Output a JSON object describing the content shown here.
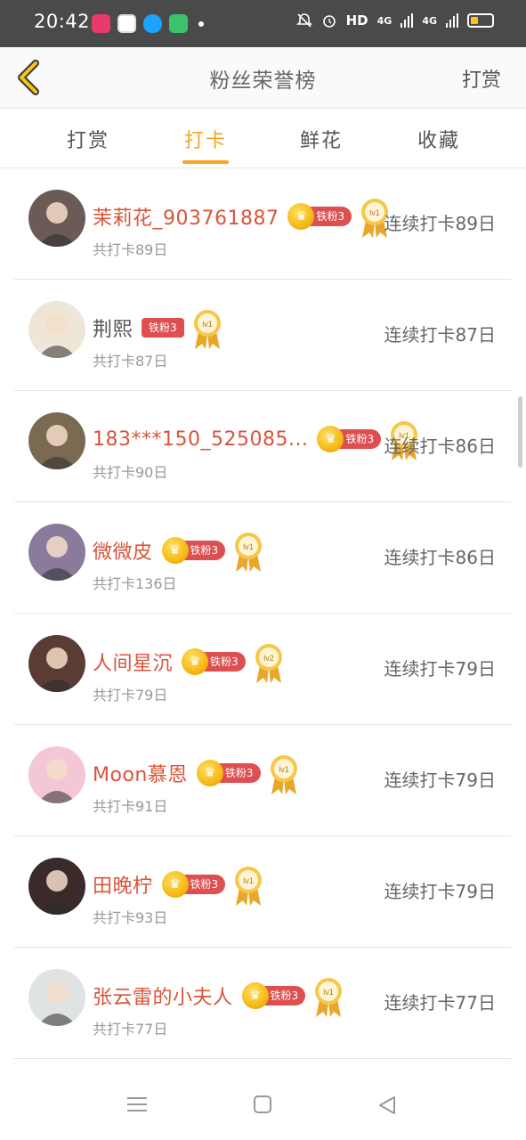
{
  "status_bar": {
    "time": "20:42",
    "network": "HD",
    "sig1": "4G",
    "sig2": "4G"
  },
  "header": {
    "title": "粉丝荣誉榜",
    "right_action": "打赏"
  },
  "tabs": [
    {
      "label": "打赏",
      "active": false
    },
    {
      "label": "打卡",
      "active": true
    },
    {
      "label": "鲜花",
      "active": false
    },
    {
      "label": "收藏",
      "active": false
    }
  ],
  "rows": [
    {
      "name": "茉莉花_903761887",
      "highlight": true,
      "badge": "铁粉3",
      "crown": true,
      "level": "lv1",
      "total": "共打卡89日",
      "streak": "连续打卡89日"
    },
    {
      "name": "荆熙",
      "highlight": false,
      "badge": "铁粉3",
      "crown": false,
      "level": "lv1",
      "total": "共打卡87日",
      "streak": "连续打卡87日"
    },
    {
      "name": "183***150_525085...",
      "highlight": true,
      "badge": "铁粉3",
      "crown": true,
      "level": "lv1",
      "total": "共打卡90日",
      "streak": "连续打卡86日"
    },
    {
      "name": "微微皮",
      "highlight": true,
      "badge": "铁粉3",
      "crown": true,
      "level": "lv1",
      "total": "共打卡136日",
      "streak": "连续打卡86日"
    },
    {
      "name": "人间星沉",
      "highlight": true,
      "badge": "铁粉3",
      "crown": true,
      "level": "lv2",
      "total": "共打卡79日",
      "streak": "连续打卡79日"
    },
    {
      "name": "Moon慕恩",
      "highlight": true,
      "badge": "铁粉3",
      "crown": true,
      "level": "lv1",
      "total": "共打卡91日",
      "streak": "连续打卡79日"
    },
    {
      "name": "田晚柠",
      "highlight": true,
      "badge": "铁粉3",
      "crown": true,
      "level": "lv1",
      "total": "共打卡93日",
      "streak": "连续打卡79日"
    },
    {
      "name": "张云雷的小夫人",
      "highlight": true,
      "badge": "铁粉3",
      "crown": true,
      "level": "lv1",
      "total": "共打卡77日",
      "streak": "连续打卡77日"
    }
  ],
  "avatar_colors": [
    "#6b5a55",
    "#efe6d8",
    "#7a6a52",
    "#8a7a9c",
    "#5a3c34",
    "#f3c7d6",
    "#3a2a2a",
    "#dfe3e1"
  ],
  "colors": {
    "accent": "#f5a623",
    "name_red": "#d9543a",
    "badge_red": "#dd4f50"
  },
  "nav": {
    "icons": [
      "menu-icon",
      "home-square-icon",
      "back-triangle-icon"
    ]
  }
}
